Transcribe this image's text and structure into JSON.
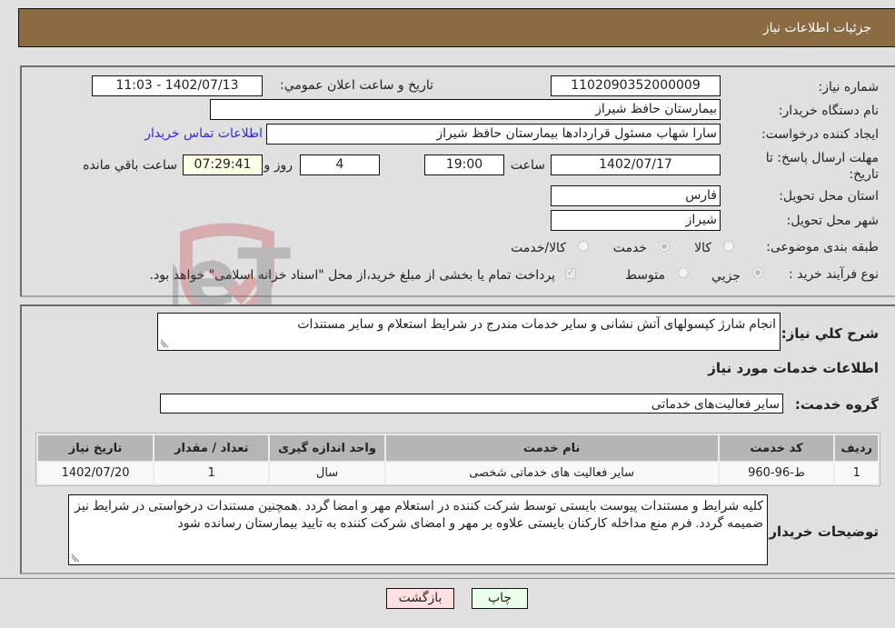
{
  "header": {
    "title": "جزئیات اطلاعات نیاز"
  },
  "form": {
    "need_number": {
      "label": "شماره نیاز:",
      "value": "1102090352000009"
    },
    "announce_datetime": {
      "label": "تاریخ و ساعت اعلان عمومي:",
      "value": "1402/07/13 - 11:03"
    },
    "buyer_org": {
      "label": "نام دستگاه خریدار:",
      "value": "بیمارستان حافظ شیراز"
    },
    "requester": {
      "label": "ایجاد کننده درخواست:",
      "value": "سارا شهاب مسئول قراردادها بیمارستان حافظ شیراز"
    },
    "buyer_contact_link": "اطلاعات تماس خریدار",
    "deadline": {
      "label": "مهلت ارسال پاسخ: تا تاریخ:",
      "date": "1402/07/17",
      "time_label": "ساعت",
      "time": "19:00",
      "days": "4",
      "days_label": "روز و",
      "remaining": "07:29:41",
      "remaining_label": "ساعت باقي مانده"
    },
    "province": {
      "label": "استان محل تحویل:",
      "value": "فارس"
    },
    "city": {
      "label": "شهر محل تحویل:",
      "value": "شیراز"
    },
    "category": {
      "label": "طبقه بندی موضوعی:",
      "options": [
        "کالا",
        "خدمت",
        "کالا/خدمت"
      ],
      "selected": "خدمت"
    },
    "purchase_type": {
      "label": "نوع فرآیند خرید :",
      "options": [
        "جزیي",
        "متوسط"
      ],
      "selected": "جزیي",
      "treasury_note": "پرداخت تمام یا بخشی از مبلغ خرید،از محل \"اسناد خزانه اسلامی\" خواهد بود."
    }
  },
  "details": {
    "general_desc_label": "شرح کلي نیاز:",
    "general_desc": "انجام شارژ کپسولهای آتش نشانی و سایر خدمات مندرج در شرایط استعلام و سایر مستندات",
    "services_heading": "اطلاعات خدمات مورد نیاز",
    "service_group_label": "گروه خدمت:",
    "service_group": "سایر فعالیت‌های خدماتی",
    "table": {
      "headers": [
        "ردیف",
        "کد خدمت",
        "نام خدمت",
        "واحد اندازه گیری",
        "تعداد / مقدار",
        "تاریخ نیاز"
      ],
      "rows": [
        [
          "1",
          "ط-96-960",
          "سایر فعالیت های خدماتی شخصی",
          "سال",
          "1",
          "1402/07/20"
        ]
      ]
    },
    "buyer_notes_label": "توضیحات خریدار:",
    "buyer_notes": "کلیه شرایط و مستندات پیوست بایستی توسط شرکت کننده در استعلام مهر و امضا گردد .همچنین مستندات درخواستی در شرایط نیز ضمیمه گردد. فرم منع مداخله کارکنان بایستی علاوه بر مهر و امضای شرکت کننده به تایید بیمارستان رسانده شود"
  },
  "buttons": {
    "print": "چاپ",
    "back": "بازگشت"
  },
  "watermark": {
    "text": "AriaTender.neT"
  },
  "colors": {
    "header": "#8b6b42",
    "link": "#2b2bd8",
    "back_button": "#ffe0e0",
    "print_button": "#eaffea"
  }
}
